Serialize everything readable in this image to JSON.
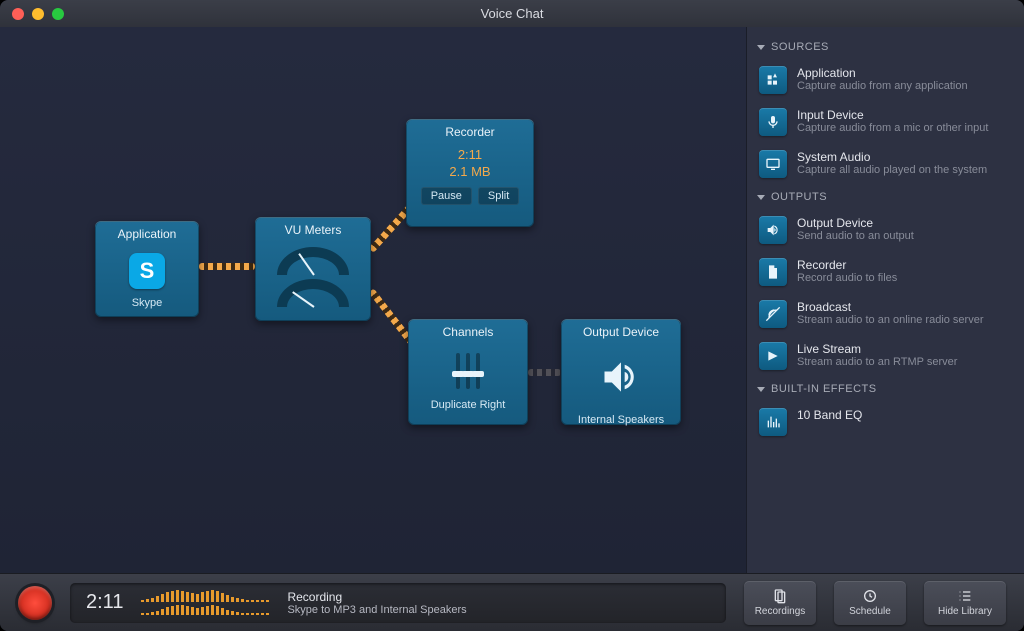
{
  "window": {
    "title": "Voice Chat"
  },
  "nodes": {
    "application": {
      "title": "Application",
      "sub": "Skype"
    },
    "vu_meters": {
      "title": "VU Meters"
    },
    "recorder": {
      "title": "Recorder",
      "time": "2:11",
      "size": "2.1 MB",
      "pause": "Pause",
      "split": "Split"
    },
    "channels": {
      "title": "Channels",
      "sub": "Duplicate Right"
    },
    "output": {
      "title": "Output Device",
      "sub": "Internal Speakers"
    }
  },
  "sidebar": {
    "sources": {
      "head": "SOURCES",
      "items": [
        {
          "title": "Application",
          "desc": "Capture audio from any application",
          "icon": "app"
        },
        {
          "title": "Input Device",
          "desc": "Capture audio from a mic or other input",
          "icon": "mic"
        },
        {
          "title": "System Audio",
          "desc": "Capture all audio played on the system",
          "icon": "screen"
        }
      ]
    },
    "outputs": {
      "head": "OUTPUTS",
      "items": [
        {
          "title": "Output Device",
          "desc": "Send audio to an output",
          "icon": "speaker"
        },
        {
          "title": "Recorder",
          "desc": "Record audio to files",
          "icon": "file"
        },
        {
          "title": "Broadcast",
          "desc": "Stream audio to an online radio server",
          "icon": "broadcast"
        },
        {
          "title": "Live Stream",
          "desc": "Stream audio to an RTMP server",
          "icon": "stream"
        }
      ]
    },
    "effects": {
      "head": "BUILT-IN EFFECTS",
      "items": [
        {
          "title": "10 Band EQ",
          "desc": "",
          "icon": "eq"
        }
      ]
    }
  },
  "bottombar": {
    "time": "2:11",
    "status_l1": "Recording",
    "status_l2": "Skype to MP3 and Internal Speakers",
    "buttons": {
      "recordings": "Recordings",
      "schedule": "Schedule",
      "hide_library": "Hide Library"
    }
  }
}
